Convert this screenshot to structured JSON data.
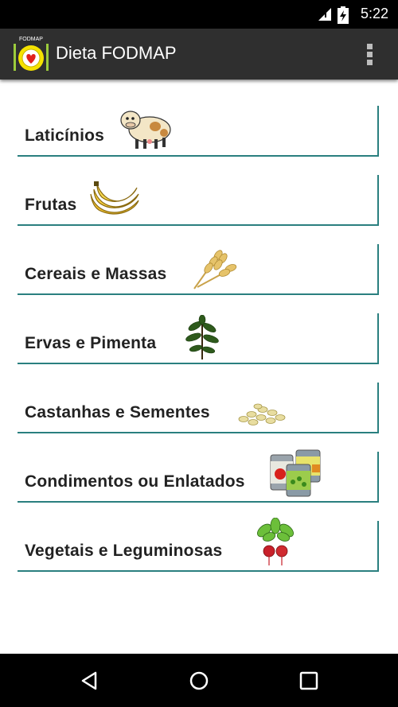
{
  "status": {
    "time": "5:22"
  },
  "appbar": {
    "logo_text": "FODMAP",
    "title": "Dieta FODMAP"
  },
  "categories": [
    {
      "label": "Laticínios",
      "icon": "cow-icon"
    },
    {
      "label": "Frutas",
      "icon": "banana-icon"
    },
    {
      "label": "Cereais e Massas",
      "icon": "wheat-icon"
    },
    {
      "label": "Ervas e Pimenta",
      "icon": "herb-icon"
    },
    {
      "label": "Castanhas e Sementes",
      "icon": "seeds-icon"
    },
    {
      "label": "Condimentos ou Enlatados",
      "icon": "cans-icon"
    },
    {
      "label": "Vegetais e Leguminosas",
      "icon": "radish-icon"
    }
  ],
  "colors": {
    "accent": "#2a7f7f",
    "appbar": "#2f2f2f"
  }
}
